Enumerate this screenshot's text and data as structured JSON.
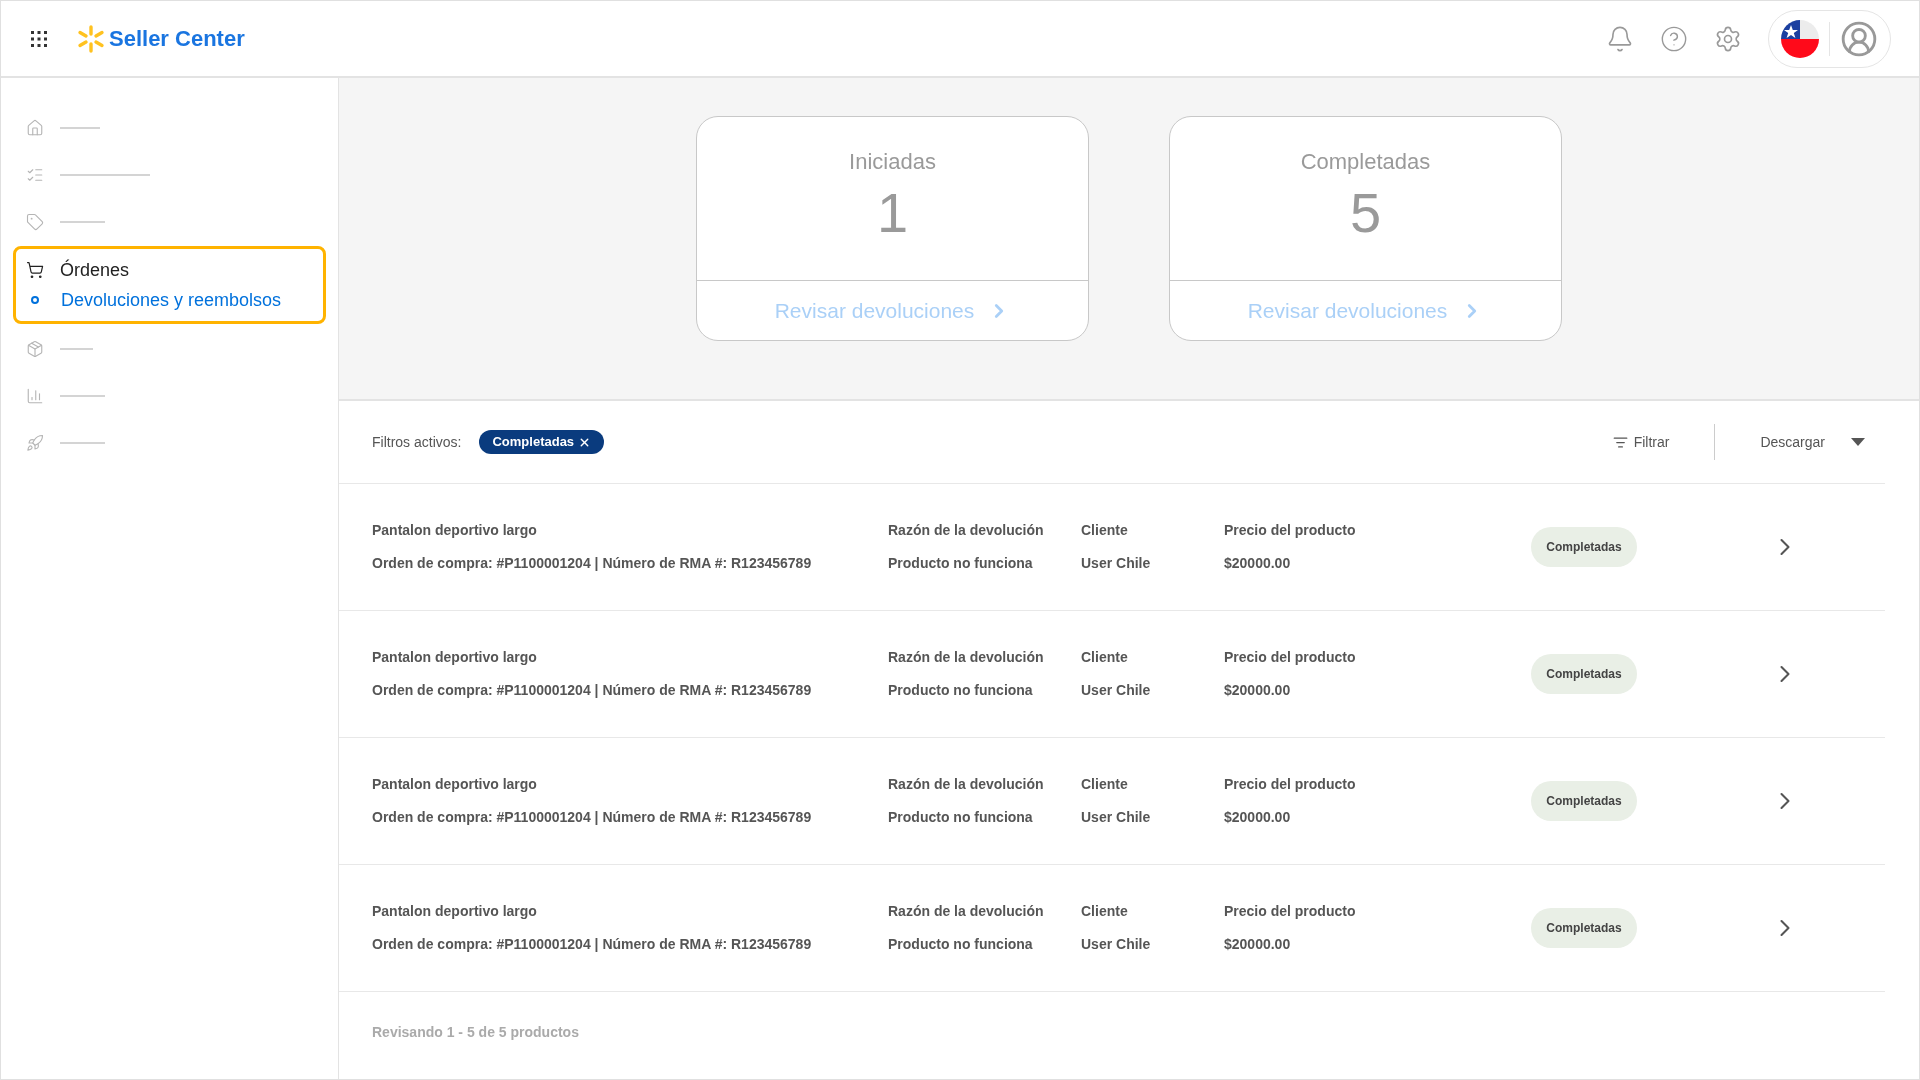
{
  "header": {
    "logo_text": "Seller Center"
  },
  "sidebar": {
    "items": [
      {
        "kind": "placeholder"
      },
      {
        "kind": "placeholder"
      },
      {
        "kind": "placeholder"
      },
      {
        "kind": "section",
        "label": "Órdenes",
        "highlighted": true,
        "children": [
          {
            "label": "Devoluciones y reembolsos",
            "selected": true
          }
        ]
      },
      {
        "kind": "placeholder"
      },
      {
        "kind": "placeholder"
      },
      {
        "kind": "placeholder"
      }
    ]
  },
  "summary_cards": [
    {
      "title": "Iniciadas",
      "count": "1",
      "link": "Revisar devoluciones"
    },
    {
      "title": "Completadas",
      "count": "5",
      "link": "Revisar devoluciones"
    }
  ],
  "filters": {
    "label": "Filtros activos:",
    "chips": [
      {
        "label": "Completadas"
      }
    ],
    "filter_button": "Filtrar",
    "download_button": "Descargar"
  },
  "returns": [
    {
      "product": "Pantalon deportivo largo",
      "order": "Orden de compra: #P1100001204 | Número de RMA #: R123456789",
      "reason_label": "Razón de la devolución",
      "reason": "Producto no funciona",
      "client_label": "Cliente",
      "client": "User Chile",
      "price_label": "Precio del producto",
      "price": "$20000.00",
      "status": "Completadas"
    },
    {
      "product": "Pantalon deportivo largo",
      "order": "Orden de compra: #P1100001204 | Número de RMA #: R123456789",
      "reason_label": "Razón de la devolución",
      "reason": "Producto no funciona",
      "client_label": "Cliente",
      "client": "User Chile",
      "price_label": "Precio del producto",
      "price": "$20000.00",
      "status": "Completadas"
    },
    {
      "product": "Pantalon deportivo largo",
      "order": "Orden de compra: #P1100001204 | Número de RMA #: R123456789",
      "reason_label": "Razón de la devolución",
      "reason": "Producto no funciona",
      "client_label": "Cliente",
      "client": "User Chile",
      "price_label": "Precio del producto",
      "price": "$20000.00",
      "status": "Completadas"
    },
    {
      "product": "Pantalon deportivo largo",
      "order": "Orden de compra: #P1100001204 | Número de RMA #: R123456789",
      "reason_label": "Razón de la devolución",
      "reason": "Producto no funciona",
      "client_label": "Cliente",
      "client": "User Chile",
      "price_label": "Precio del producto",
      "price": "$20000.00",
      "status": "Completadas"
    }
  ],
  "footer": {
    "summary": "Revisando 1 - 5 de 5 productos"
  }
}
